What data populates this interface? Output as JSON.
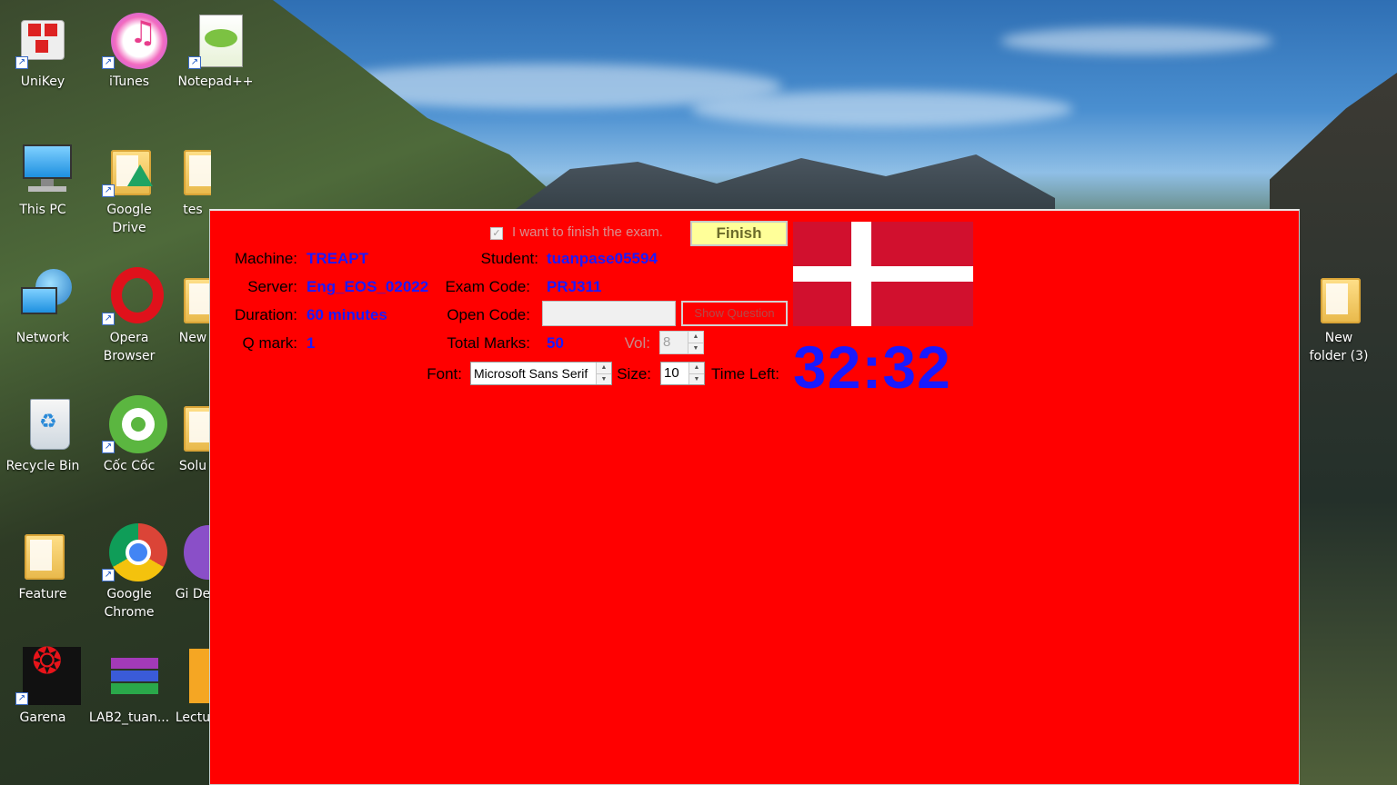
{
  "desktop": {
    "icons_left": [
      {
        "label": "UniKey"
      },
      {
        "label": "iTunes"
      },
      {
        "label": "Notepad++"
      },
      {
        "label": "This PC"
      },
      {
        "label": "Google Drive"
      },
      {
        "label": "tes"
      },
      {
        "label": "Network"
      },
      {
        "label": "Opera Browser"
      },
      {
        "label": "New"
      },
      {
        "label": "Recycle Bin"
      },
      {
        "label": "Cốc Cốc"
      },
      {
        "label": "Solu"
      },
      {
        "label": "Feature"
      },
      {
        "label": "Google Chrome"
      },
      {
        "label": "Gi De"
      },
      {
        "label": "Garena"
      },
      {
        "label": "LAB2_tuan..."
      },
      {
        "label": "Lectu"
      }
    ],
    "icon_right": {
      "label": "New folder (3)"
    }
  },
  "exam": {
    "finish_check_label": "I want to finish the exam.",
    "finish_check_mark": "✓",
    "finish_button": "Finish",
    "machine_label": "Machine:",
    "machine_value": "TREAPT",
    "student_label": "Student:",
    "student_value": "tuanpase05594",
    "server_label": "Server:",
    "server_value": "Eng_EOS_02022",
    "exam_code_label": "Exam Code:",
    "exam_code_value": "PRJ311",
    "duration_label": "Duration:",
    "duration_value": "60 minutes",
    "open_code_label": "Open Code:",
    "open_code_value": "",
    "show_question_button": "Show Question",
    "q_mark_label": "Q mark:",
    "q_mark_value": "1",
    "total_marks_label": "Total Marks:",
    "total_marks_value": "50",
    "vol_label": "Vol:",
    "vol_value": "8",
    "font_label": "Font:",
    "font_value": "Microsoft Sans Serif",
    "size_label": "Size:",
    "size_value": "10",
    "time_left_label": "Time Left:",
    "time_left_value": "32:32",
    "flag_colors": {
      "field": "#d1102e",
      "cross": "#ffffff"
    }
  }
}
